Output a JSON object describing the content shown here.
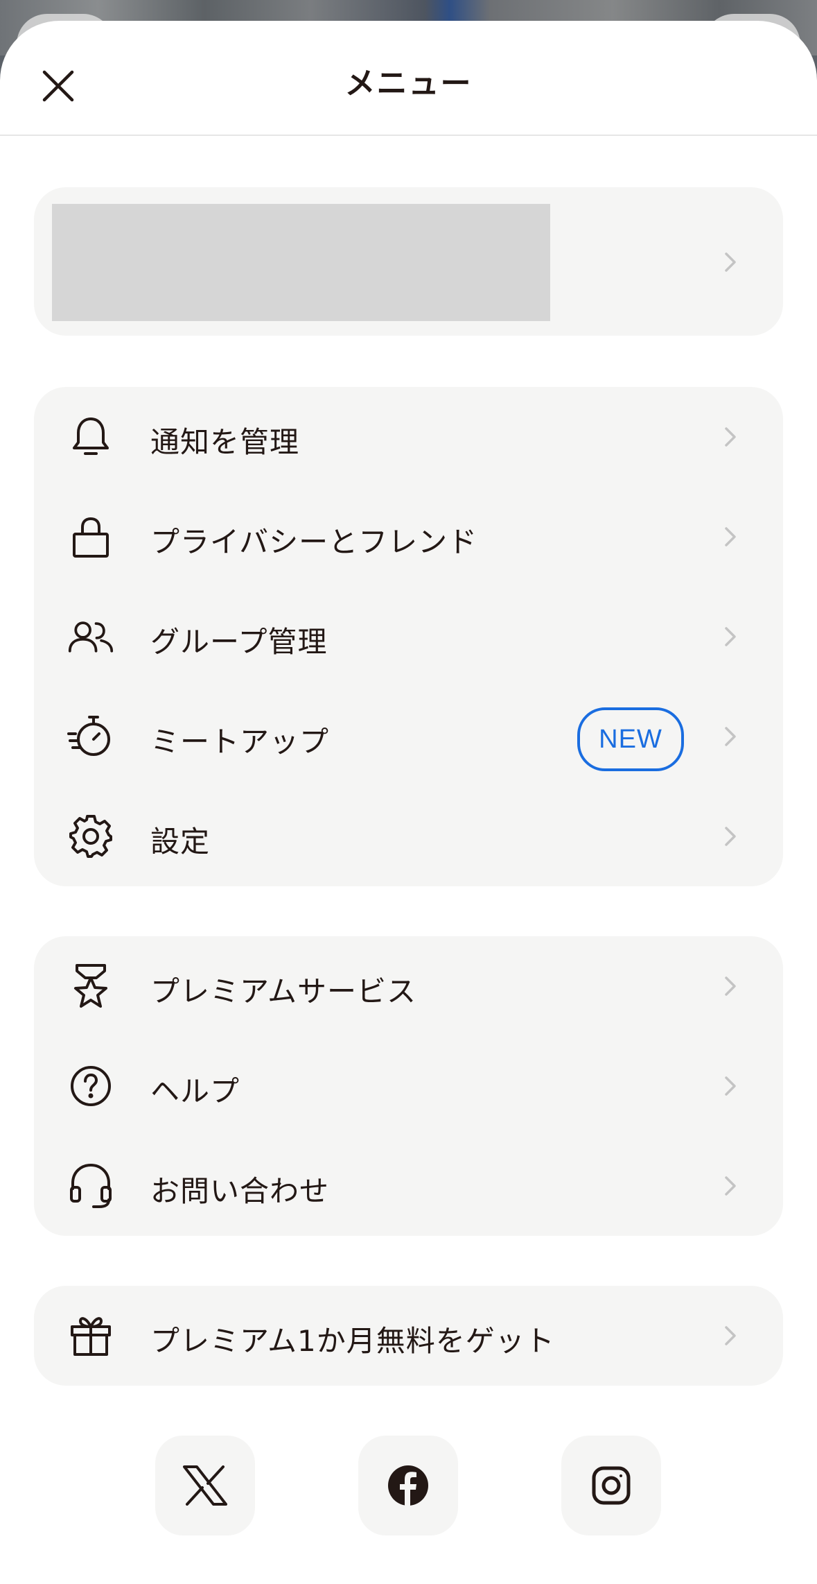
{
  "header": {
    "title": "メニュー"
  },
  "profile": {},
  "menu_group_1": [
    {
      "label": "通知を管理",
      "icon": "bell-icon"
    },
    {
      "label": "プライバシーとフレンド",
      "icon": "lock-icon"
    },
    {
      "label": "グループ管理",
      "icon": "group-icon"
    },
    {
      "label": "ミートアップ",
      "icon": "stopwatch-icon",
      "badge": "NEW"
    },
    {
      "label": "設定",
      "icon": "gear-icon"
    }
  ],
  "menu_group_2": [
    {
      "label": "プレミアムサービス",
      "icon": "medal-star-icon"
    },
    {
      "label": "ヘルプ",
      "icon": "help-icon"
    },
    {
      "label": "お問い合わせ",
      "icon": "headset-icon"
    }
  ],
  "menu_group_3": [
    {
      "label": "プレミアム1か月無料をゲット",
      "icon": "gift-icon"
    }
  ],
  "socials": [
    "x-icon",
    "facebook-icon",
    "instagram-icon"
  ],
  "colors": {
    "badge_blue": "#1a6de0",
    "card_bg": "#f5f5f4",
    "text": "#231815",
    "chevron": "#c4c4c4"
  }
}
